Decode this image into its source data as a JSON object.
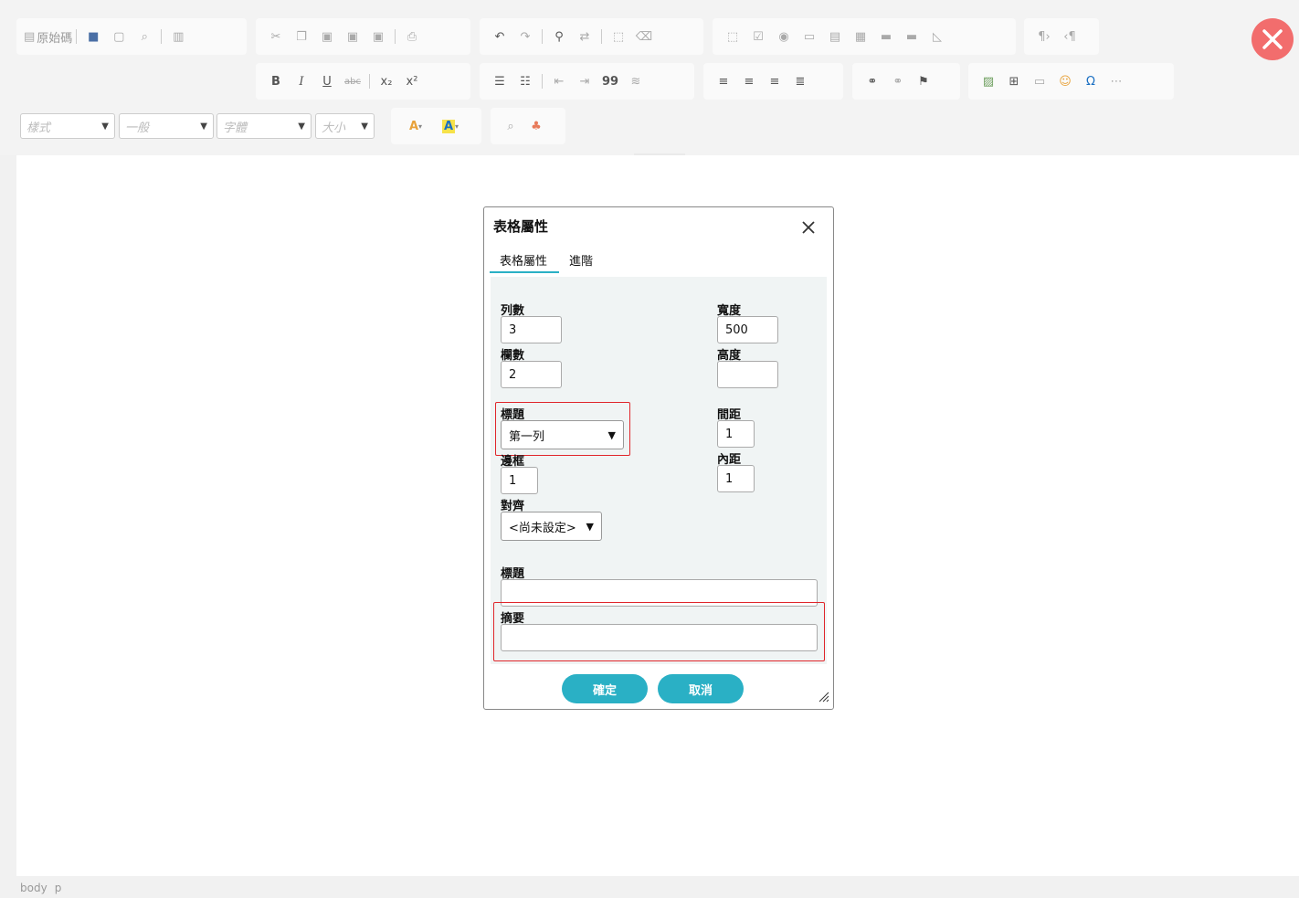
{
  "toolbar": {
    "source_label": "原始碼",
    "row1_icons": [
      "source-icon",
      "save-icon",
      "new-page-icon",
      "preview-icon",
      "templates-icon",
      "cut-icon",
      "copy-icon",
      "paste-icon",
      "paste-text-icon",
      "paste-word-icon",
      "print-icon",
      "undo-icon",
      "redo-icon",
      "find-icon",
      "replace-icon",
      "select-all-icon",
      "remove-format-icon",
      "form-icon",
      "checkbox-icon",
      "radio-icon",
      "textfield-icon",
      "textarea-icon",
      "select-icon",
      "button-icon",
      "image-button-icon",
      "hidden-field-icon",
      "ltr-icon",
      "rtl-icon"
    ],
    "bold": "B",
    "italic": "I",
    "underline": "U",
    "strike": "abc",
    "subscript": "x₂",
    "superscript": "x²",
    "blockquote": "99",
    "omega": "Ω",
    "text_color": "A",
    "bg_color": "A",
    "style_combo": "樣式",
    "format_combo": "一般",
    "font_combo": "字體",
    "size_combo": "大小",
    "close_button": "✕"
  },
  "statusbar": {
    "path": [
      "body",
      "p"
    ]
  },
  "dialog": {
    "title": "表格屬性",
    "close": "✕",
    "tabs": [
      "表格屬性",
      "進階"
    ],
    "fields": {
      "rows_label": "列數",
      "rows_value": "3",
      "cols_label": "欄數",
      "cols_value": "2",
      "headers_label": "標題",
      "headers_value": "第一列",
      "border_label": "邊框",
      "border_value": "1",
      "align_label": "對齊",
      "align_value": "<尚未設定>",
      "width_label": "寬度",
      "width_value": "500",
      "height_label": "高度",
      "height_value": "",
      "spacing_label": "間距",
      "spacing_value": "1",
      "padding_label": "內距",
      "padding_value": "1",
      "caption_label": "標題",
      "caption_value": "",
      "summary_label": "摘要",
      "summary_value": ""
    },
    "ok": "確定",
    "cancel": "取消"
  },
  "colors": {
    "accent": "#2ab0c5",
    "highlight": "#e0262b",
    "close_red": "#f26d6d"
  }
}
